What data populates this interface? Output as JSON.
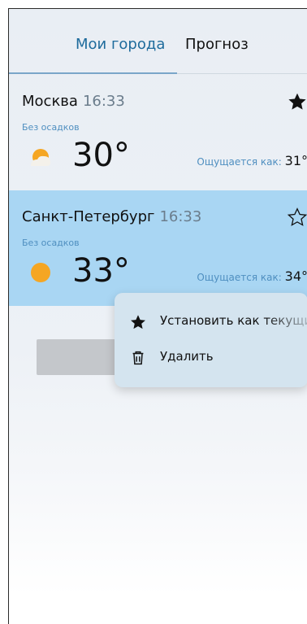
{
  "tabs": [
    {
      "label": "Мои города",
      "active": true
    },
    {
      "label": "Прогноз",
      "active": false
    }
  ],
  "cities": [
    {
      "name": "Москва",
      "time": "16:33",
      "precip": "Без осадков",
      "temp": "30°",
      "feels_label": "Ощущается как:",
      "feels_value": "31°",
      "favorite": true,
      "icon": "partly-cloudy-sun-icon"
    },
    {
      "name": "Санкт-Петербург",
      "time": "16:33",
      "precip": "Без осадков",
      "temp": "33°",
      "feels_label": "Ощущается как:",
      "feels_value": "34°",
      "favorite": false,
      "icon": "sun-icon"
    }
  ],
  "context_menu": {
    "items": [
      {
        "label": "Установить как текущий",
        "icon": "star-icon"
      },
      {
        "label": "Удалить",
        "icon": "trash-icon"
      }
    ]
  },
  "colors": {
    "accent": "#1e6b9c",
    "selected_card": "#a9d6f3",
    "sun": "#f5a623"
  }
}
